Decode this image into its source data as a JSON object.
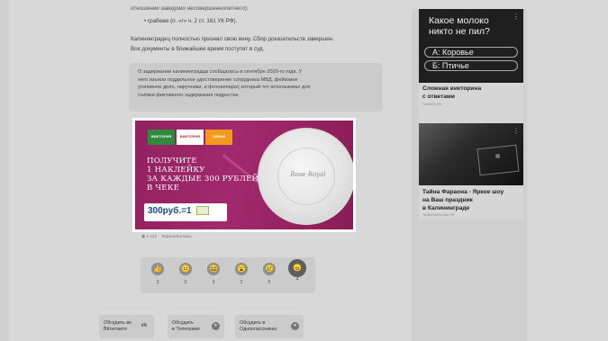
{
  "article": {
    "top_line": "отношении заведомо несовершеннолетнего);",
    "bullet": "грабеже (п. «г» ч. 2 ст. 161 УК РФ).",
    "para1": "Калининградец полностью признал свою вину. Сбор доказательств завершен.",
    "para2": "Все документы в ближайшее время поступят в суд.",
    "quote_lines": [
      "О задержании калининградца сообщалось в сентябре 2020-го года. У",
      "него изъяли поддельное удостоверение сотрудника МВД, фейковое",
      "уголовное дело, наручники, и фотоаппарат, который тот использовал для",
      "съёмки фиктивного задержания подростка."
    ],
    "views": "2 112",
    "views_tag": "Журналистика"
  },
  "ad": {
    "logos": [
      "ВИКТОРИЯ",
      "ВИКТОРИЯ",
      "СЕМЬЯ"
    ],
    "headline": [
      "ПОЛУЧИТЕ",
      "1 НАКЛЕЙКУ",
      "ЗА КАЖДЫЕ 300 РУБЛЕЙ",
      "В ЧЕКЕ"
    ],
    "price": "300руб.=1",
    "plate_brand": "Rose Royal",
    "colors": {
      "bg": "#a2296e",
      "plate": "#ececec"
    }
  },
  "reactions": {
    "items": [
      {
        "icon": "thumbs-up-icon",
        "count": "3"
      },
      {
        "icon": "neutral-face-icon",
        "count": "0"
      },
      {
        "icon": "laughing-face-icon",
        "count": "3"
      },
      {
        "icon": "surprised-face-icon",
        "count": "2"
      },
      {
        "icon": "sad-face-icon",
        "count": "0"
      },
      {
        "icon": "angry-face-icon",
        "count": "4"
      }
    ]
  },
  "share": {
    "vk": [
      "Обсудить во",
      "ВКонтакте"
    ],
    "tg": [
      "Обсудить",
      "в Телеграме"
    ],
    "ok": [
      "Обсудить в",
      "Одноклассниках"
    ]
  },
  "sidebar": {
    "quiz": {
      "title": [
        "Какое молоко",
        "никто не пил?"
      ],
      "options": [
        "А:  Коровье",
        "Б:  Птичье"
      ],
      "caption": [
        "Сложная викторина",
        "с ответами"
      ],
      "source": "YANDEX.RU"
    },
    "story": {
      "source_top": "",
      "caption": [
        "Тайна Фараона - Яркое шоу",
        "на Ваш праздник",
        "в Калининграде"
      ],
      "source": "TAINAFARAONA.РФ"
    }
  }
}
